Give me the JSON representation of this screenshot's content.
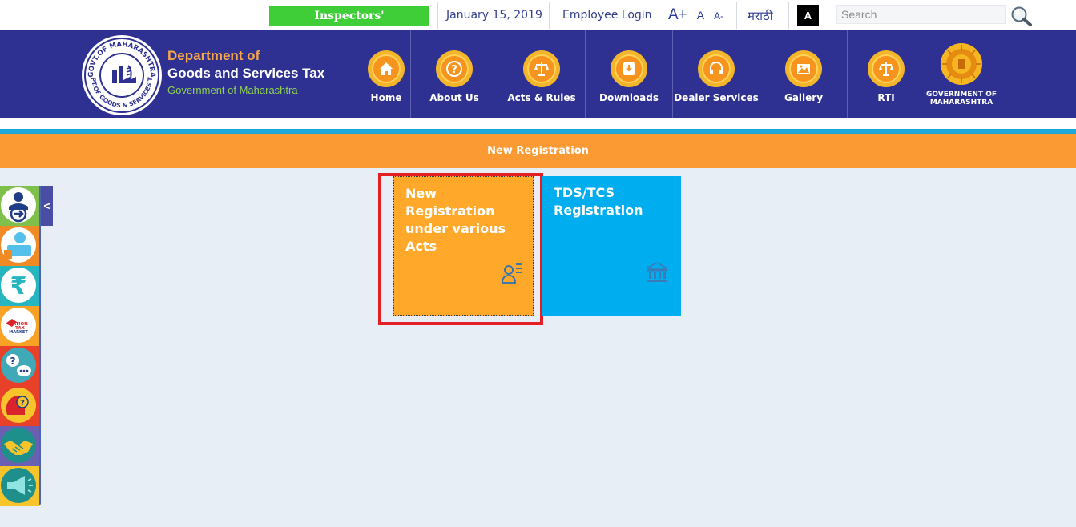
{
  "topbar": {
    "inspectors_label": "Inspectors'",
    "date": "January 15, 2019",
    "employee_login": "Employee Login",
    "font_increase": "A+",
    "font_normal": "A",
    "font_decrease": "A-",
    "language": "मराठी",
    "contrast_label": "A",
    "search_placeholder": "Search"
  },
  "header": {
    "dept_line1": "Department of",
    "dept_line2": "Goods and Services Tax",
    "dept_line3": "Government of Maharashtra",
    "seal_text_top": "GOVT.OF MAHARASHTRA",
    "seal_text_bottom": "DEPT.OF GOODS & SERVICES TAX",
    "nav": [
      {
        "label": "Home",
        "icon": "home-icon"
      },
      {
        "label": "About Us",
        "icon": "question-icon"
      },
      {
        "label": "Acts & Rules",
        "icon": "scales-icon"
      },
      {
        "label": "Downloads",
        "icon": "download-icon"
      },
      {
        "label": "Dealer Services",
        "icon": "headset-icon"
      },
      {
        "label": "Gallery",
        "icon": "image-icon"
      },
      {
        "label": "RTI",
        "icon": "scales-icon"
      }
    ],
    "gov_label": "GOVERNMENT OF MAHARASHTRA"
  },
  "banner": {
    "title": "New Registration"
  },
  "tiles": {
    "new_registration": "New Registration under various Acts",
    "tds_tcs": "TDS/TCS Registration"
  },
  "rail": {
    "toggle": "<",
    "items": [
      "login-arrow-icon",
      "user-computer-icon",
      "rupee-icon",
      "nation-tax-market-logo",
      "faq-chat-icon",
      "help-head-icon",
      "handshake-icon",
      "megaphone-icon"
    ],
    "nation_tax_logo_text": "NATION TAX MARKET"
  },
  "colors": {
    "header_bg": "#2e3192",
    "banner_bg": "#fb9a33",
    "tile_orange": "#ffa829",
    "tile_blue": "#00adef",
    "inspectors_green": "#3fce38",
    "highlight_red": "#e31e24"
  }
}
